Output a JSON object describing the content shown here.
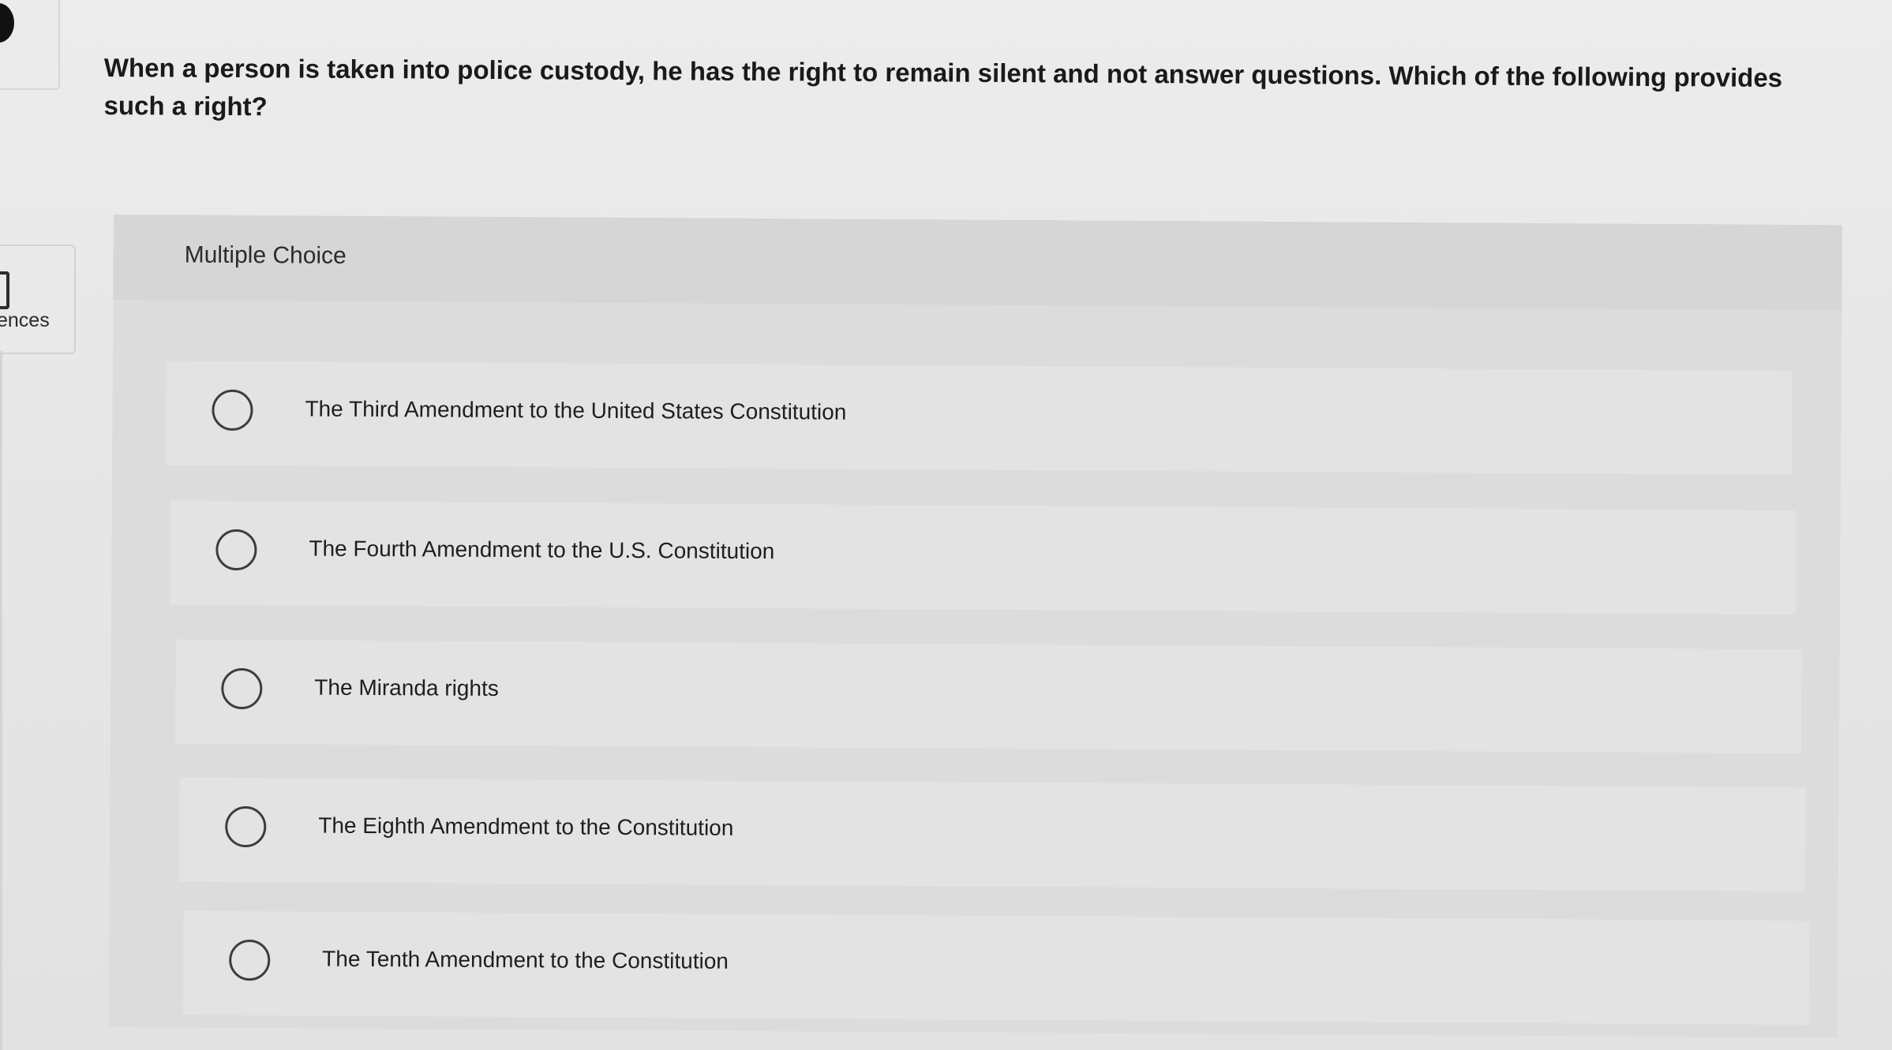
{
  "sidebar": {
    "references_label": "ences"
  },
  "question": {
    "text": "When a person is taken into police custody, he has the right to remain silent and not answer questions. Which of the following provides such a right?"
  },
  "multiple_choice": {
    "header": "Multiple Choice",
    "options": [
      {
        "label": "The Third Amendment to the United States Constitution"
      },
      {
        "label": "The Fourth Amendment to the U.S. Constitution"
      },
      {
        "label": "The Miranda rights"
      },
      {
        "label": "The Eighth Amendment to the Constitution"
      },
      {
        "label": "The Tenth Amendment to the Constitution"
      }
    ]
  }
}
